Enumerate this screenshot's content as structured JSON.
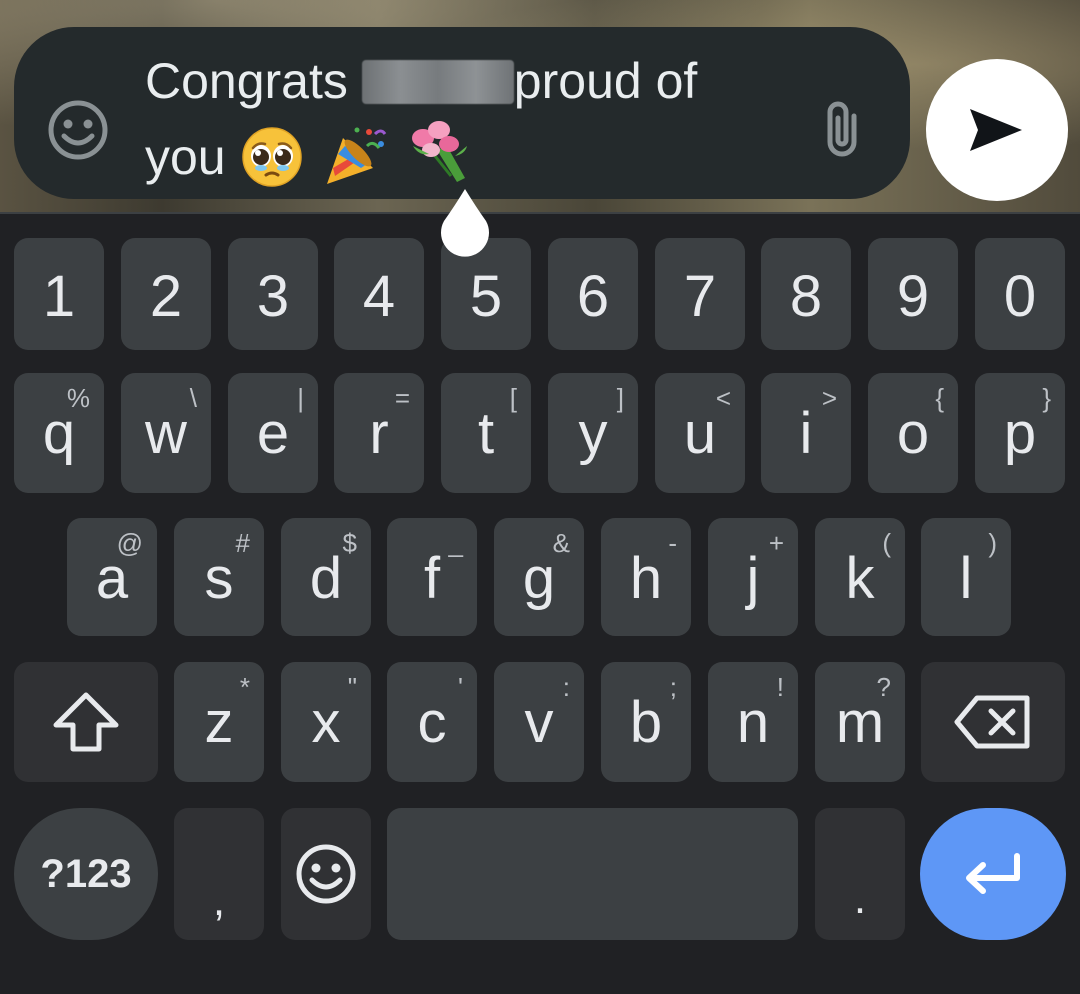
{
  "composer": {
    "text_before": "Congrats",
    "text_after": "proud of",
    "text_line2": "you",
    "emojis": [
      "🥹",
      "🎉",
      "💐"
    ],
    "emoji_button_icon": "smiley-icon",
    "attach_icon": "paperclip-icon",
    "send_icon": "send-arrow-icon"
  },
  "keyboard": {
    "number_row": [
      "1",
      "2",
      "3",
      "4",
      "5",
      "6",
      "7",
      "8",
      "9",
      "0"
    ],
    "row1": [
      {
        "key": "q",
        "alt": "%"
      },
      {
        "key": "w",
        "alt": "\\"
      },
      {
        "key": "e",
        "alt": "|"
      },
      {
        "key": "r",
        "alt": "="
      },
      {
        "key": "t",
        "alt": "["
      },
      {
        "key": "y",
        "alt": "]"
      },
      {
        "key": "u",
        "alt": "<"
      },
      {
        "key": "i",
        "alt": ">"
      },
      {
        "key": "o",
        "alt": "{"
      },
      {
        "key": "p",
        "alt": "}"
      }
    ],
    "row2": [
      {
        "key": "a",
        "alt": "@"
      },
      {
        "key": "s",
        "alt": "#"
      },
      {
        "key": "d",
        "alt": "$"
      },
      {
        "key": "f",
        "alt": "_"
      },
      {
        "key": "g",
        "alt": "&"
      },
      {
        "key": "h",
        "alt": "-"
      },
      {
        "key": "j",
        "alt": "+"
      },
      {
        "key": "k",
        "alt": "("
      },
      {
        "key": "l",
        "alt": ")"
      }
    ],
    "row3": [
      {
        "key": "z",
        "alt": "*"
      },
      {
        "key": "x",
        "alt": "\""
      },
      {
        "key": "c",
        "alt": "'"
      },
      {
        "key": "v",
        "alt": ":"
      },
      {
        "key": "b",
        "alt": ";"
      },
      {
        "key": "n",
        "alt": "!"
      },
      {
        "key": "m",
        "alt": "?"
      }
    ],
    "symbols_label": "?123",
    "comma_label": ",",
    "period_label": ".",
    "shift_icon": "shift-arrow-icon",
    "backspace_icon": "backspace-icon",
    "emoji_key_icon": "smiley-icon",
    "enter_icon": "enter-return-icon",
    "accent_color": "#5e97f6"
  }
}
